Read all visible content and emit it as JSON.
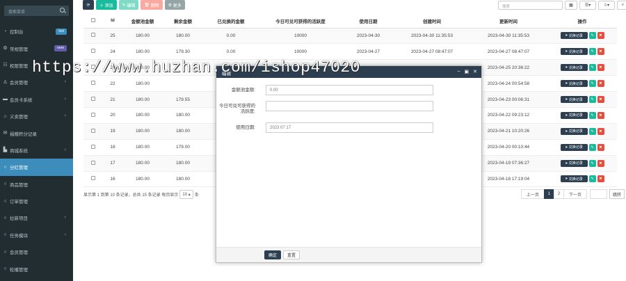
{
  "sidebar": {
    "search_placeholder": "搜索菜单",
    "items": [
      {
        "label": "控制台",
        "icon": "dashboard-icon",
        "badge": "hot",
        "badge_color": "#3c8dbc"
      },
      {
        "label": "常规管理",
        "icon": "gear-icon",
        "badge": "new",
        "badge_color": "#605ca8"
      },
      {
        "label": "权限管理",
        "icon": "users-icon",
        "caret": "‹"
      },
      {
        "label": "会员管理",
        "icon": "user-icon",
        "caret": "‹"
      },
      {
        "label": "会员卡系统",
        "icon": "card-icon",
        "caret": "‹"
      },
      {
        "label": "义卖管理",
        "icon": "cart-icon",
        "caret": "‹"
      },
      {
        "label": "捐赠积分记录",
        "icon": "gift-icon"
      },
      {
        "label": "商城系统",
        "icon": "store-icon",
        "caret": "‹"
      },
      {
        "label": "分红管理",
        "icon": "circle-icon",
        "active": true
      },
      {
        "label": "商品管理",
        "icon": "circle-icon"
      },
      {
        "label": "订单管理",
        "icon": "circle-icon"
      },
      {
        "label": "拉新项目",
        "icon": "circle-icon",
        "caret": "‹"
      },
      {
        "label": "任务模块",
        "icon": "circle-icon",
        "caret": "‹"
      },
      {
        "label": "会员管理",
        "icon": "circle-icon"
      },
      {
        "label": "轮播管理",
        "icon": "circle-icon"
      }
    ]
  },
  "toolbar": {
    "add": "添加",
    "edit": "编辑",
    "delete": "删除",
    "more": "更多"
  },
  "search": {
    "placeholder": "搜索"
  },
  "table": {
    "headers": [
      "",
      "Id",
      "金额池金额",
      "剩余金额",
      "已兑换的金额",
      "今日可兑可获得的活跃度",
      "使用日期",
      "创建时间",
      "更新时间",
      "操作"
    ],
    "rows": [
      [
        "25",
        "180.00",
        "180.00",
        "0.00",
        "10000",
        "2023-04-30",
        "2023-04-30 11:35:53",
        "2023-04-30 11:35:53"
      ],
      [
        "24",
        "180.00",
        "179.30",
        "0.00",
        "10000",
        "2023-04-27",
        "2023-04-27 08:47:07",
        "2023-04-27 08:47:07"
      ],
      [
        "23",
        "180.00",
        "",
        "",
        "",
        "",
        "",
        "2023-04-25 20:36:22"
      ],
      [
        "22",
        "180.00",
        "",
        "",
        "",
        "",
        "",
        "2023-04-24 00:54:58"
      ],
      [
        "21",
        "180.00",
        "179.55",
        "",
        "",
        "",
        "",
        "2023-04-23 00:06:31"
      ],
      [
        "20",
        "180.00",
        "180.00",
        "",
        "",
        "",
        "",
        "2023-04-22 09:23:12"
      ],
      [
        "19",
        "180.00",
        "180.00",
        "",
        "",
        "",
        "",
        "2023-04-21 10:20:26"
      ],
      [
        "18",
        "180.00",
        "179.00",
        "",
        "",
        "",
        "",
        "2023-04-20 00:10:44"
      ],
      [
        "17",
        "180.00",
        "180.00",
        "",
        "",
        "",
        "",
        "2023-04-19 07:36:27"
      ],
      [
        "16",
        "180.00",
        "180.00",
        "",
        "",
        "",
        "",
        "2023-04-18 17:19:04"
      ]
    ],
    "op_log_label": "兑换记录"
  },
  "pager": {
    "info": "显示第 1 到第 10 条记录，总共 15 条记录 每页显示",
    "per_page": "10 ▴",
    "info_tail": "条",
    "prev": "上一页",
    "pages": [
      "1",
      "2"
    ],
    "next": "下一页",
    "jump": "跳转"
  },
  "watermark": "https://www.huzhan.com/ishop47020",
  "modal": {
    "title": "编辑",
    "field1_label": "金额池金额:",
    "field1_value": "0.00",
    "field2_label": "今日可兑可获得的活跃度:",
    "field2_value": "",
    "field3_label": "使用日期:",
    "field3_value": "2023 07 17",
    "ok": "确定",
    "reset": "重置"
  }
}
